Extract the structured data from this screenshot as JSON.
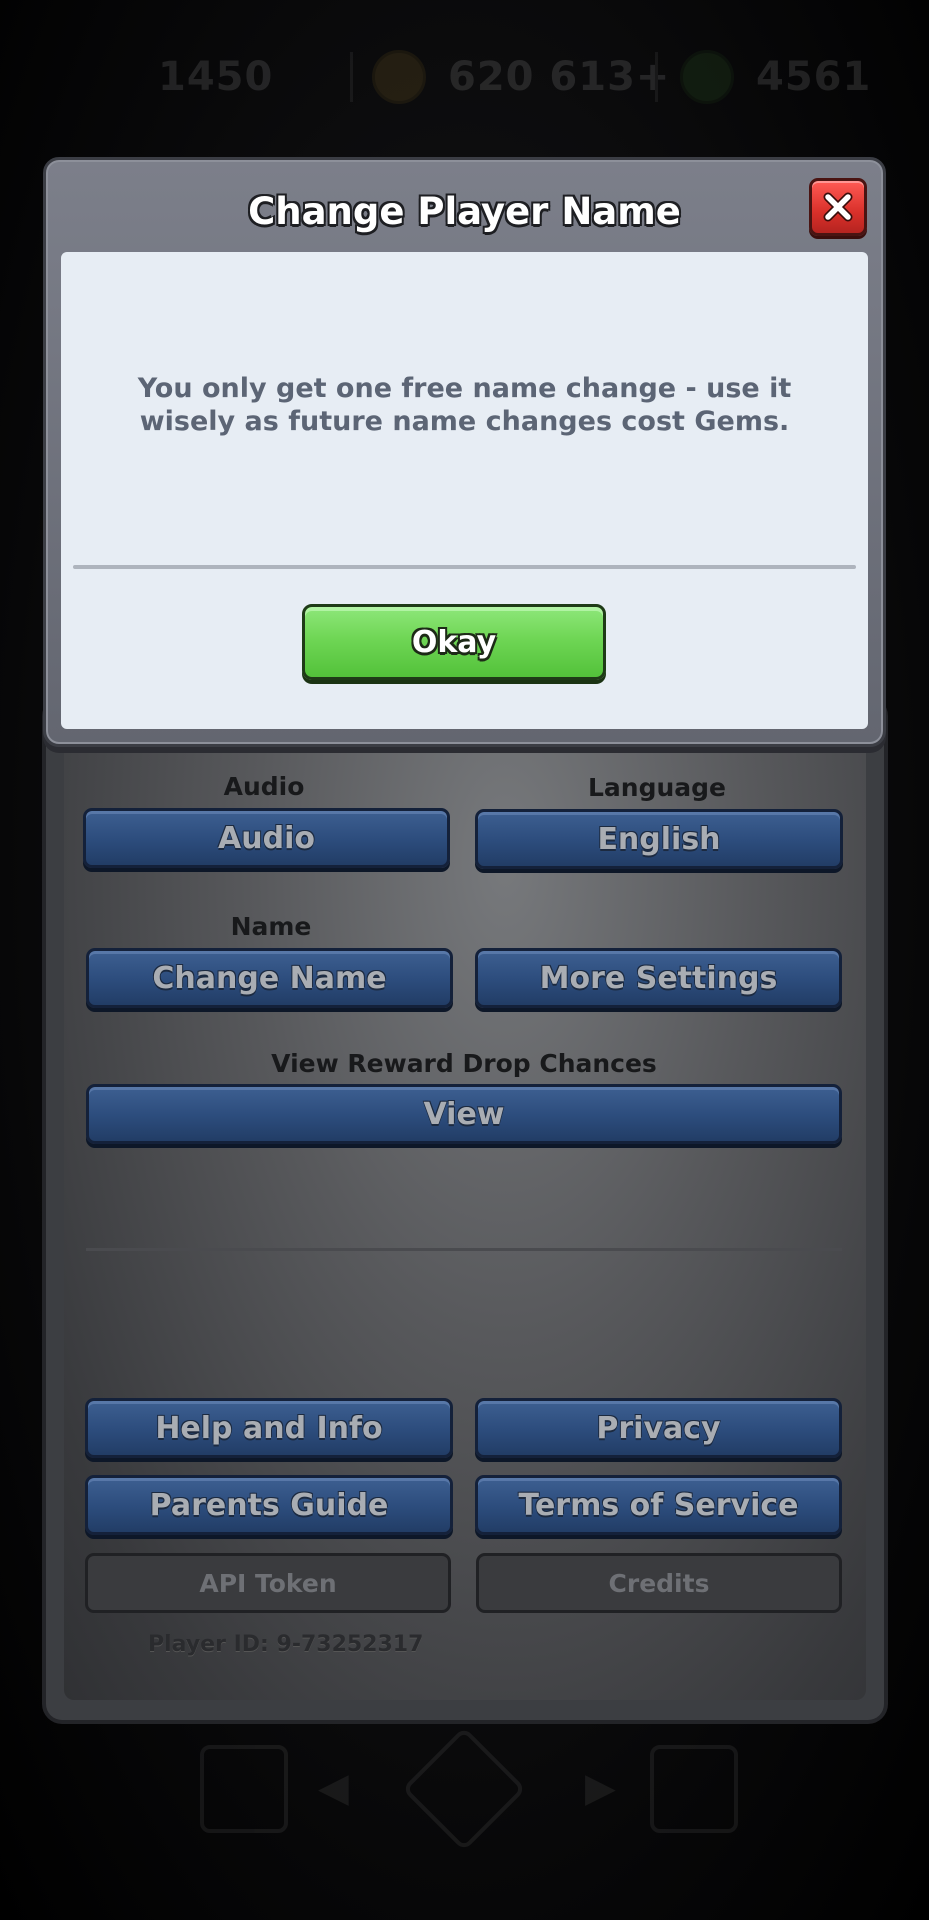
{
  "hud": {
    "trophies": "1450",
    "gold": "620 613+",
    "gems": "4561"
  },
  "dialog": {
    "title": "Change Player Name",
    "message": "You only get one free name change - use it wisely as future name changes cost Gems.",
    "okay_label": "Okay",
    "close_icon": "close-icon"
  },
  "settings": {
    "audio_label": "Audio",
    "audio_button": "Audio",
    "language_label": "Language",
    "language_button": "English",
    "name_label": "Name",
    "change_name_button": "Change Name",
    "more_settings_button": "More Settings",
    "reward_label": "View Reward Drop Chances",
    "view_button": "View",
    "help_button": "Help and Info",
    "privacy_button": "Privacy",
    "parents_guide_button": "Parents Guide",
    "terms_button": "Terms of Service",
    "api_token_button": "API Token",
    "credits_button": "Credits",
    "player_id": "Player ID: 9-73252317"
  },
  "colors": {
    "dialog_frame": "#6f727c",
    "dialog_body": "#e7edf4",
    "okay_green": "#6fd655",
    "close_red": "#d9302a",
    "settings_blue": "#2c4c7c"
  }
}
